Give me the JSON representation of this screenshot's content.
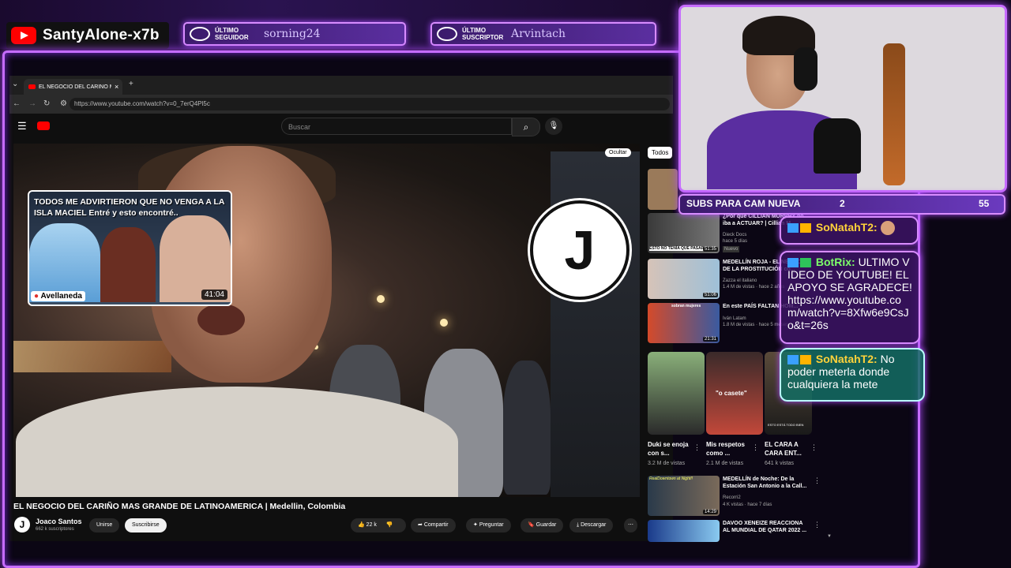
{
  "overlay": {
    "channel_name": "SantyAlone-x7b",
    "last_follower_label_1": "ÚLTIMO",
    "last_follower_label_2": "SEGUIDOR",
    "last_follower_value": "sorning24",
    "last_sub_label_1": "ÚLTIMO",
    "last_sub_label_2": "SUSCRIPTOR",
    "last_sub_value": "Arvintach",
    "subs_goal_label": "SUBS PARA CAM NUEVA",
    "subs_goal_current": "2",
    "subs_goal_target": "55",
    "accent_color": "#c66cff"
  },
  "browser": {
    "tab_title": "EL NEGOCIO DEL CARIÑO MÁS",
    "tab_close": "×",
    "new_tab": "+",
    "url": "https://www.youtube.com/watch?v=0_7erQ4Pl5c"
  },
  "youtube": {
    "search_placeholder": "Buscar",
    "ocultar": "Ocultar",
    "thumb_card_text": "TODOS ME ADVIRTIERON QUE NO VENGA A LA ISLA MACIEL  Entré y esto encontré..",
    "thumb_card_location": "Avellaneda",
    "thumb_card_duration": "41:04",
    "video_title": "EL NEGOCIO DEL CARIÑO MAS GRANDE DE LATINOAMERICA | Medellin, Colombia",
    "channel": "Joaco Santos",
    "channel_initial": "J",
    "subscribers": "662 k suscriptores",
    "join_label": "Unirse",
    "subscribe_label": "Suscribirse",
    "likes": "22 k",
    "share_label": "Compartir",
    "ask_label": "Preguntar",
    "save_label": "Guardar",
    "download_label": "Descargar",
    "chip_all": "Todos",
    "sidebar": [
      {
        "title": "¿Por qué CILLIAN MURPHY no iba a ACTUAR? | Cillian M...",
        "channel": "Dieck Docs",
        "meta": "hace 5 días",
        "badge": "Nuevo",
        "duration": "51:35",
        "thumb_text": "ESTO NO TENÍA QUE PASAR"
      },
      {
        "title": "MEDELLÍN ROJA - EL NEGOCIO DE LA PROSTITUCIÓN co...",
        "channel": "Zazza el italiano",
        "meta": "1.4 M de vistas · hace 2 años",
        "duration": "51:06"
      },
      {
        "title": "En este PAÍS FALTAN HOM...",
        "channel": "Iván Latam",
        "meta": "1.8 M de vistas · hace 5 meses",
        "duration": "21:31",
        "thumb_text": "sobran mujeres"
      },
      {
        "title": "MEDELLÍN de Noche: De la Estación San Antonio a la Call...",
        "channel": "Recorri2",
        "meta": "4 K vistas · hace 7 días",
        "duration": "14:29",
        "thumb_text": "RealDowntown at Night!!"
      },
      {
        "title": "DAVOO XENEIZE REACCIONA AL MUNDIAL DE QATAR 2022 ...",
        "channel": "",
        "meta": ""
      }
    ],
    "shorts": [
      {
        "title": "Duki se enoja con s...",
        "views": "3.2 M de vistas"
      },
      {
        "title": "Mis respetos como ...",
        "views": "2.1 M de vistas",
        "overlay": "\"o casete\""
      },
      {
        "title": "EL CARA A CARA ENT...",
        "views": "641 k vistas",
        "overlay": "ESTO ESTÁ TODO BIEN"
      }
    ]
  },
  "chat": [
    {
      "user": "SoNatahT2:",
      "text": ""
    },
    {
      "user": "BotRix:",
      "text": "ULTIMO VIDEO DE YOUTUBE! EL APOYO SE AGRADECE! https://www.youtube.com/watch?v=8Xfw6e9CsJo&t=26s"
    },
    {
      "user": "SoNatahT2:",
      "text": "No poder meterla donde cualquiera la mete"
    }
  ]
}
